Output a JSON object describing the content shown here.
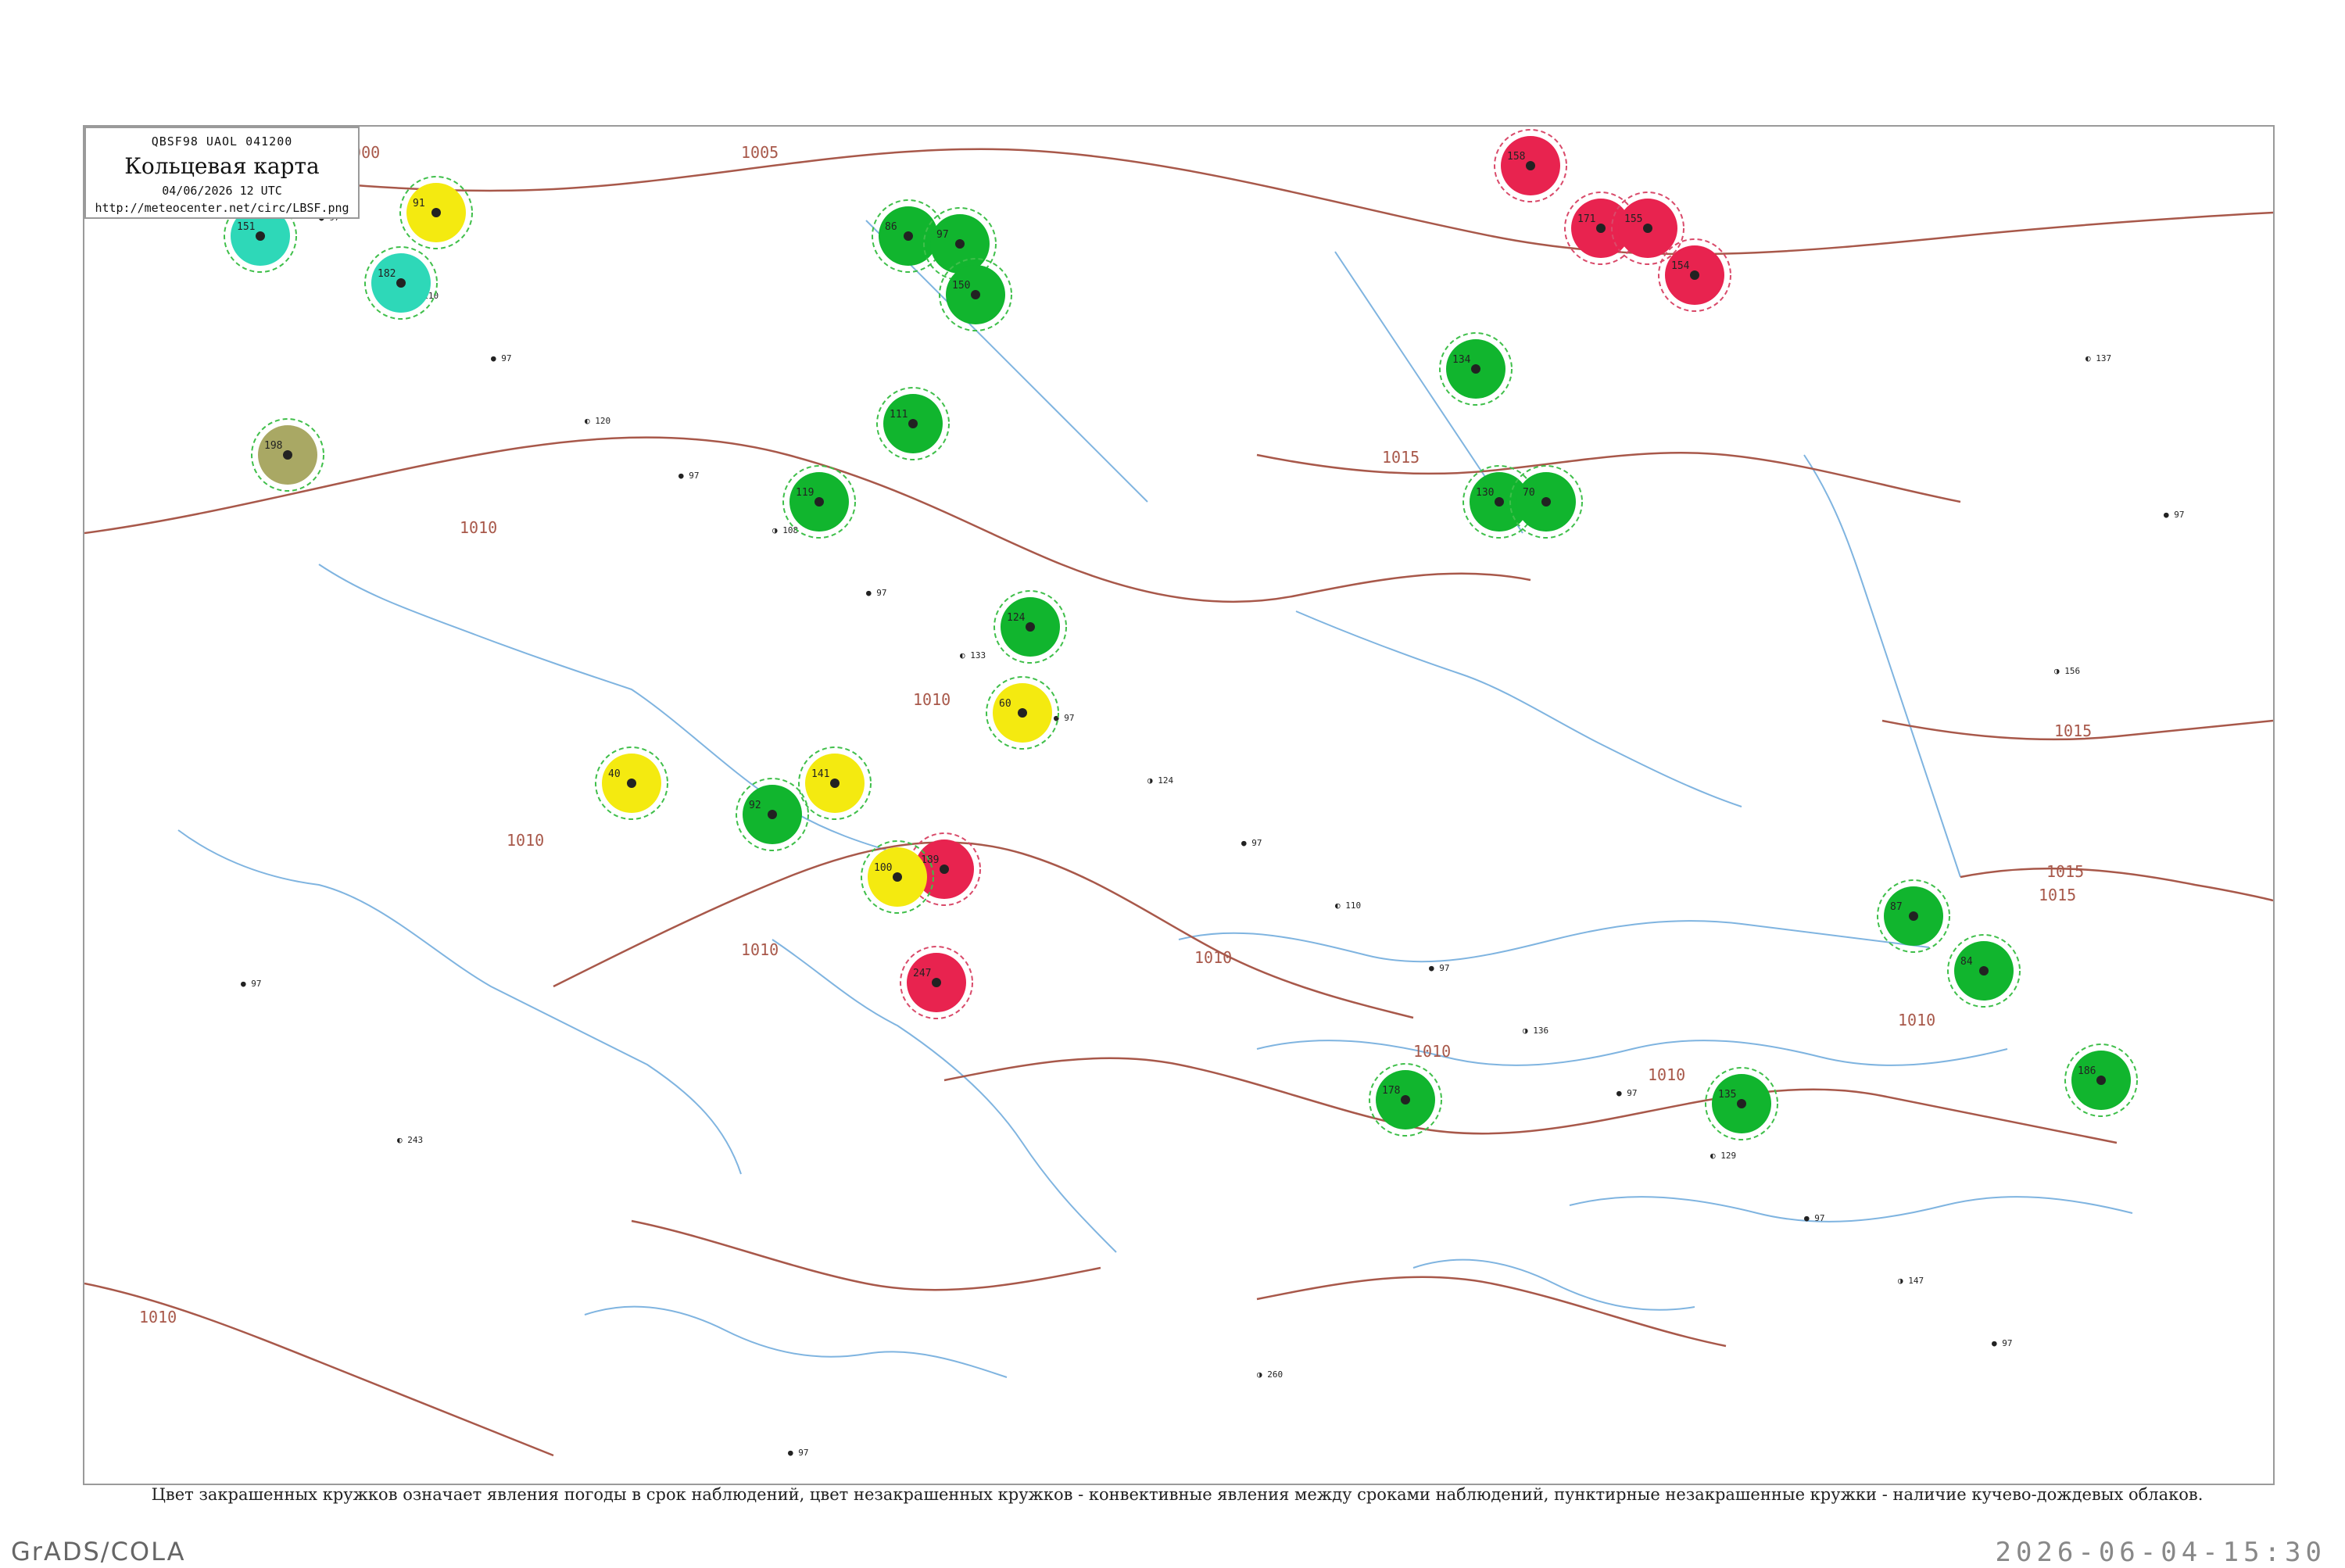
{
  "legend": {
    "code_line": "QBSF98  UAOL  041200",
    "title": "Кольцевая карта",
    "datetime": "04/06/2026 12 UTC",
    "url": "http://meteocenter.net/circ/LBSF.png"
  },
  "caption": "Цвет закрашенных кружков означает явления погоды в срок наблюдений, цвет незакрашенных кружков - конвективные явления между сроками наблюдений, пунктирные незакрашенные кружки - наличие кучево-дождевых облаков.",
  "footer": {
    "software": "GrADS/COLA",
    "generated": "2026-06-04-15:30"
  },
  "colors": {
    "rain": "#11b52e",
    "thunderstorm": "#e8234f",
    "fog": "#f4ea10",
    "haze": "#2ed8b8",
    "dust": "#a9a864",
    "isobar": "#a8584a",
    "coast": "#7fb4e0",
    "cb_ring": "#3fbf4a",
    "ts_ring": "#d94a6a"
  },
  "isobar_labels": [
    "1000",
    "1005",
    "1010",
    "1010",
    "1010",
    "1010",
    "1010",
    "1010",
    "1010",
    "1010",
    "1015",
    "1015",
    "1015",
    "1015",
    "1010"
  ],
  "stations": [
    {
      "id": "green-01",
      "type": "rain",
      "value": "86"
    },
    {
      "id": "green-02",
      "type": "rain",
      "value": "97"
    },
    {
      "id": "green-03",
      "type": "rain",
      "value": "150"
    },
    {
      "id": "green-04",
      "type": "rain",
      "value": "111"
    },
    {
      "id": "green-05",
      "type": "rain",
      "value": "119"
    },
    {
      "id": "green-06",
      "type": "rain",
      "value": "92"
    },
    {
      "id": "green-07",
      "type": "rain",
      "value": "124"
    },
    {
      "id": "green-08",
      "type": "rain",
      "value": "134"
    },
    {
      "id": "green-09",
      "type": "rain",
      "value": "130"
    },
    {
      "id": "green-10",
      "type": "rain",
      "value": "70"
    },
    {
      "id": "green-11",
      "type": "rain",
      "value": "87"
    },
    {
      "id": "green-12",
      "type": "rain",
      "value": "135"
    },
    {
      "id": "green-13",
      "type": "rain",
      "value": "178"
    },
    {
      "id": "green-14",
      "type": "rain",
      "value": "186"
    },
    {
      "id": "green-15",
      "type": "rain",
      "value": "84"
    },
    {
      "id": "red-01",
      "type": "thunderstorm",
      "value": "158"
    },
    {
      "id": "red-02",
      "type": "thunderstorm",
      "value": "171"
    },
    {
      "id": "red-03",
      "type": "thunderstorm",
      "value": "154"
    },
    {
      "id": "red-04",
      "type": "thunderstorm",
      "value": "155"
    },
    {
      "id": "red-05",
      "type": "thunderstorm",
      "value": "189"
    },
    {
      "id": "red-06",
      "type": "thunderstorm",
      "value": "247"
    },
    {
      "id": "yellow-01",
      "type": "fog",
      "value": "91"
    },
    {
      "id": "yellow-02",
      "type": "fog",
      "value": "40"
    },
    {
      "id": "yellow-03",
      "type": "fog",
      "value": "60"
    },
    {
      "id": "yellow-04",
      "type": "fog",
      "value": "141"
    },
    {
      "id": "yellow-05",
      "type": "fog",
      "value": "100"
    },
    {
      "id": "cyan-01",
      "type": "haze",
      "value": "151"
    },
    {
      "id": "cyan-02",
      "type": "haze",
      "value": "182"
    },
    {
      "id": "olive-01",
      "type": "dust",
      "value": "198"
    }
  ]
}
